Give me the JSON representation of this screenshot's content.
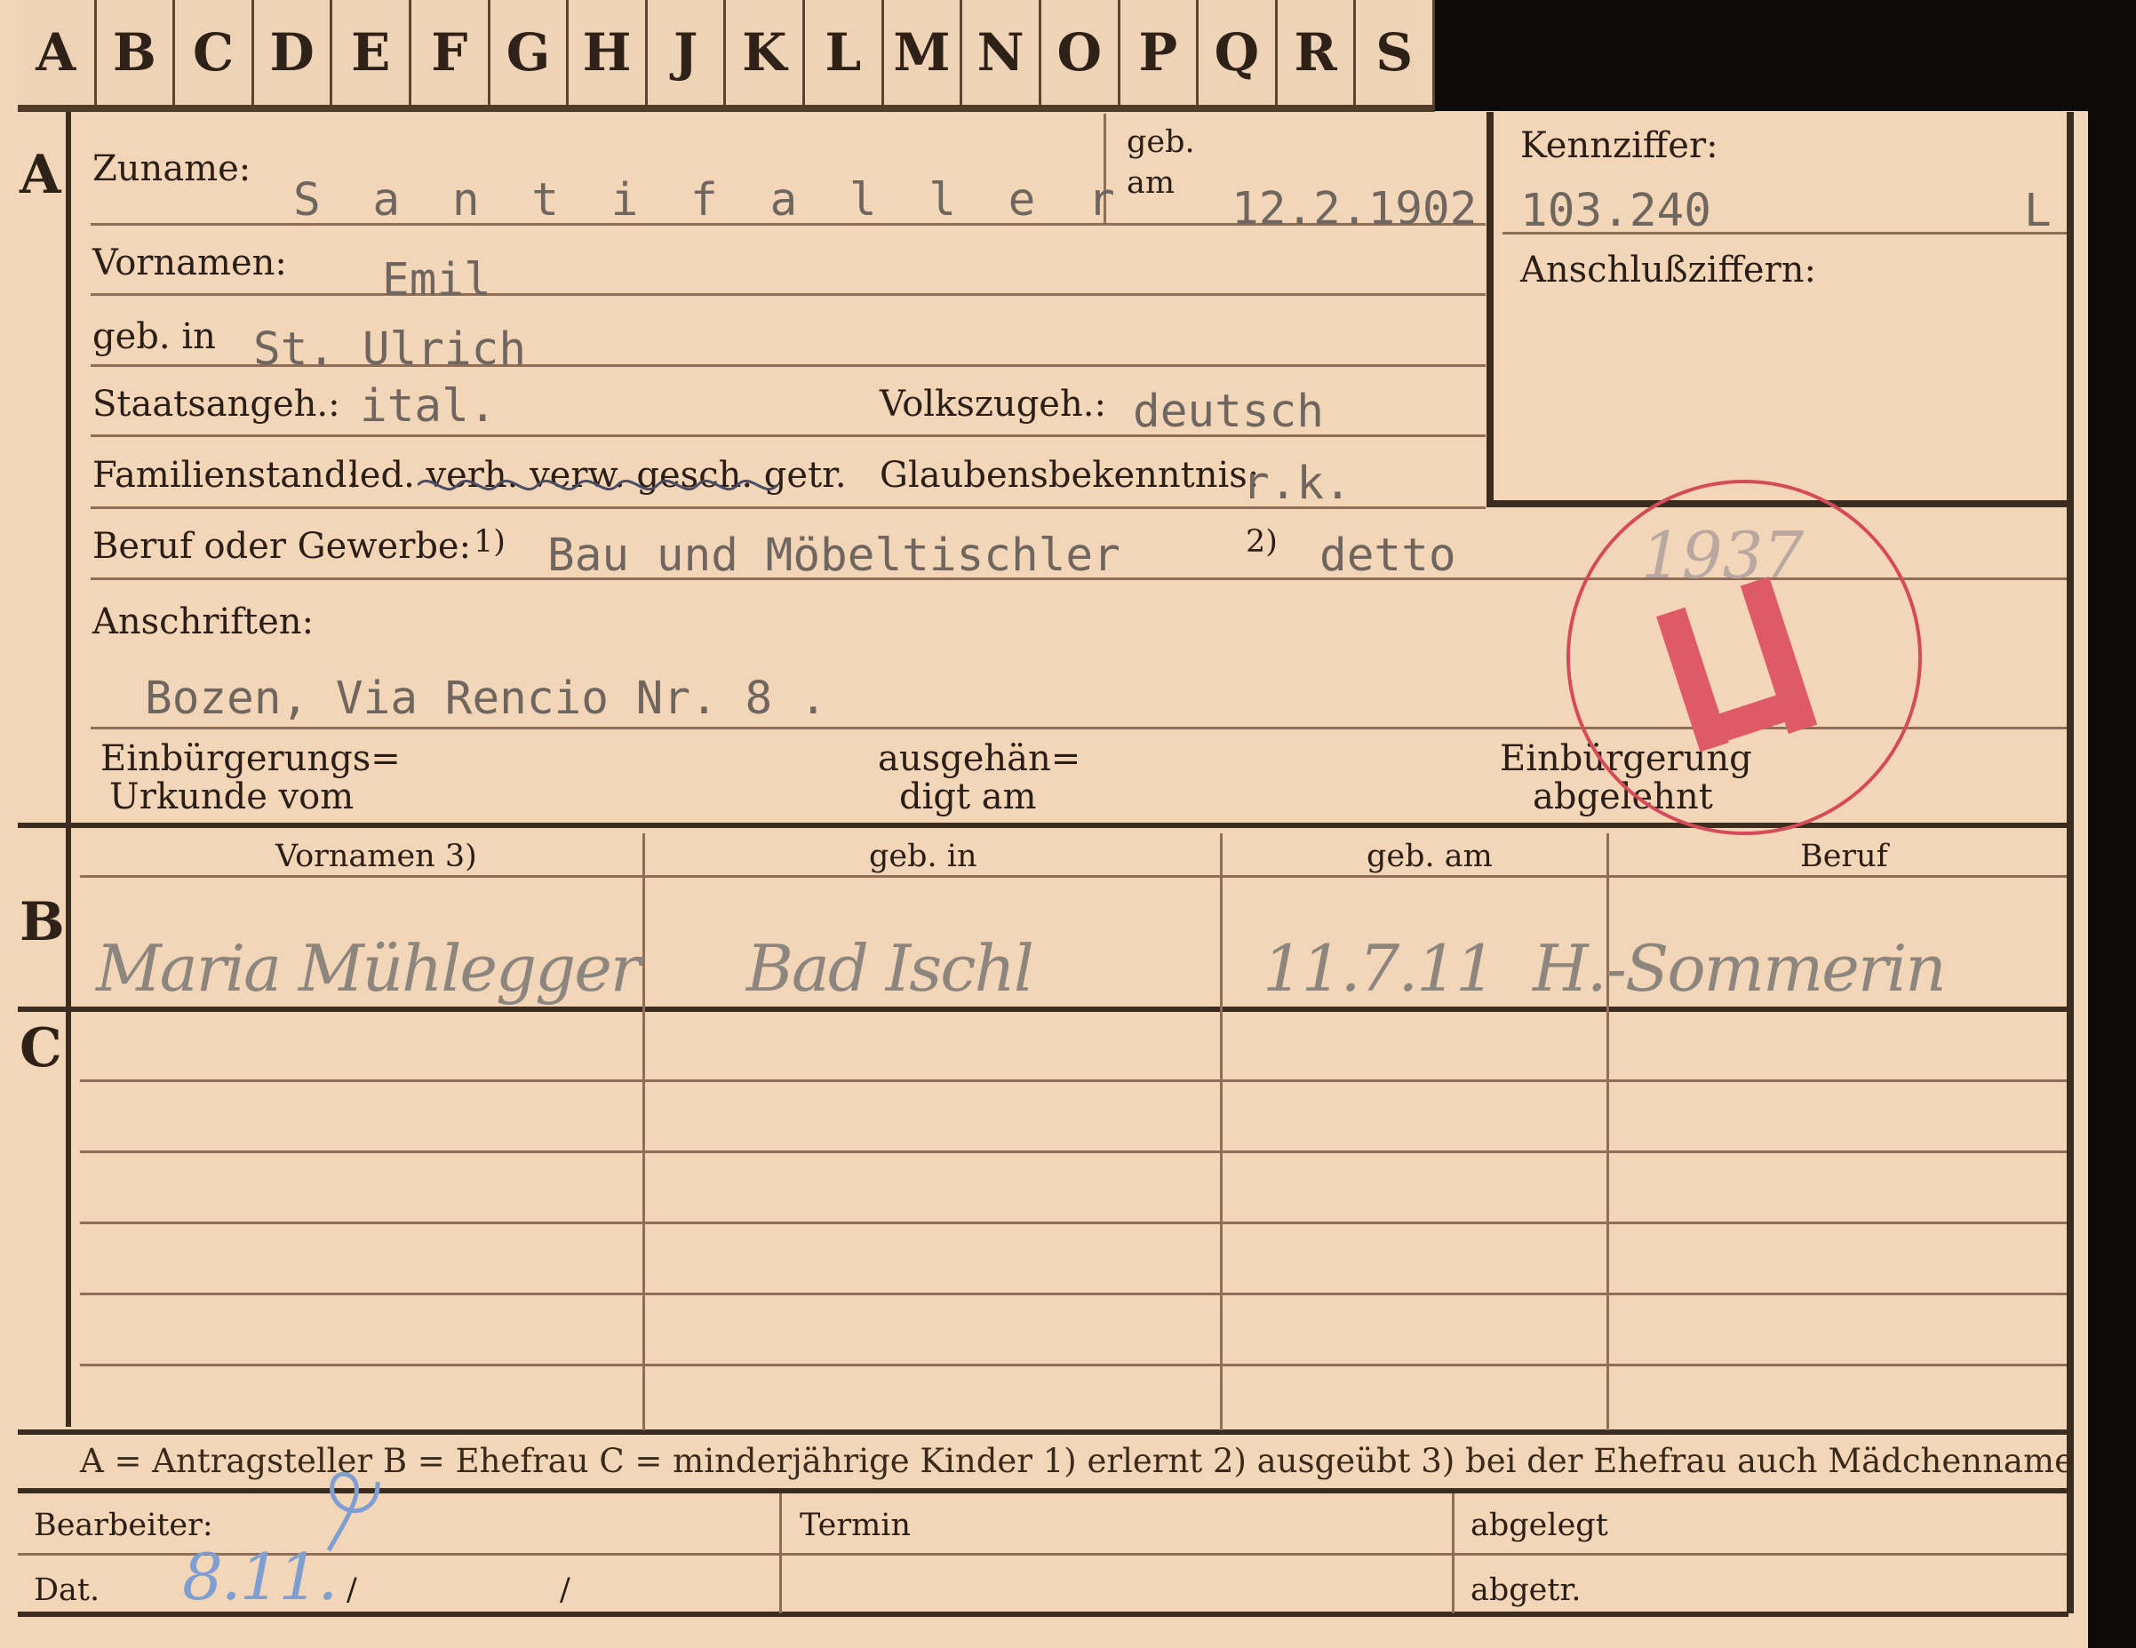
{
  "tabs": [
    "A",
    "B",
    "C",
    "D",
    "E",
    "F",
    "G",
    "H",
    "J",
    "K",
    "L",
    "M",
    "N",
    "O",
    "P",
    "Q",
    "R",
    "S"
  ],
  "sections": {
    "a": "A",
    "b": "B",
    "c": "C"
  },
  "labels": {
    "zuname": "Zuname:",
    "geb_am_top": "geb.",
    "geb_am_bottom": "am",
    "kennziffer": "Kennziffer:",
    "vornamen": "Vornamen:",
    "anschlussziffern": "Anschlußziffern:",
    "geb_in": "geb. in",
    "staatsangeh": "Staatsangeh.:",
    "volkszugeh": "Volkszugeh.:",
    "familienstand": "Familienstand:",
    "familienstand_options": "led. verh. verw. gesch. getr.",
    "glaubensbekenntnis": "Glaubensbekenntnis:",
    "beruf": "Beruf oder Gewerbe:",
    "beruf_note1": "1)",
    "beruf_note2": "2)",
    "anschriften": "Anschriften:",
    "einbuergerung1": "Einbürgerungs=",
    "einbuergerung2": "Urkunde vom",
    "ausgehaen1": "ausgehän=",
    "ausgehaen2": "digt am",
    "abgelehnt1": "Einbürgerung",
    "abgelehnt2": "abgelehnt",
    "table_headers": [
      "Vornamen 3)",
      "geb. in",
      "geb. am",
      "Beruf"
    ],
    "legend": "A = Antragsteller   B = Ehefrau   C = minderjährige Kinder   1) erlernt   2) ausgeübt   3) bei der Ehefrau auch Mädchenname",
    "bearbeiter": "Bearbeiter:",
    "termin": "Termin",
    "abgelegt": "abgelegt",
    "dat": "Dat.",
    "abgetr": "abgetr."
  },
  "values": {
    "zuname": "S a n t i f a l l e r",
    "geb_am": "12.2.1902",
    "kennziffer": "103.240",
    "kennziffer_letter": "L",
    "vornamen": "Emil",
    "geb_in": "St. Ulrich",
    "staatsangeh": "ital.",
    "volkszugeh": "deutsch",
    "glaubensbekenntnis": "r.k.",
    "beruf_erlernt": "Bau und Möbeltischler",
    "beruf_ausgeuebt": "detto",
    "anschrift": "Bozen, Via Rencio Nr. 8 .",
    "stamp_year": "1937",
    "stamp_code": "L1",
    "spouse": {
      "name": "Maria Mühlegger",
      "birthplace": "Bad Ischl",
      "birthdate": "11.7.11",
      "occupation": "H.-Sommerin"
    },
    "dat_written": "8.11.",
    "dat_sep1": "/",
    "dat_sep2": "/"
  }
}
